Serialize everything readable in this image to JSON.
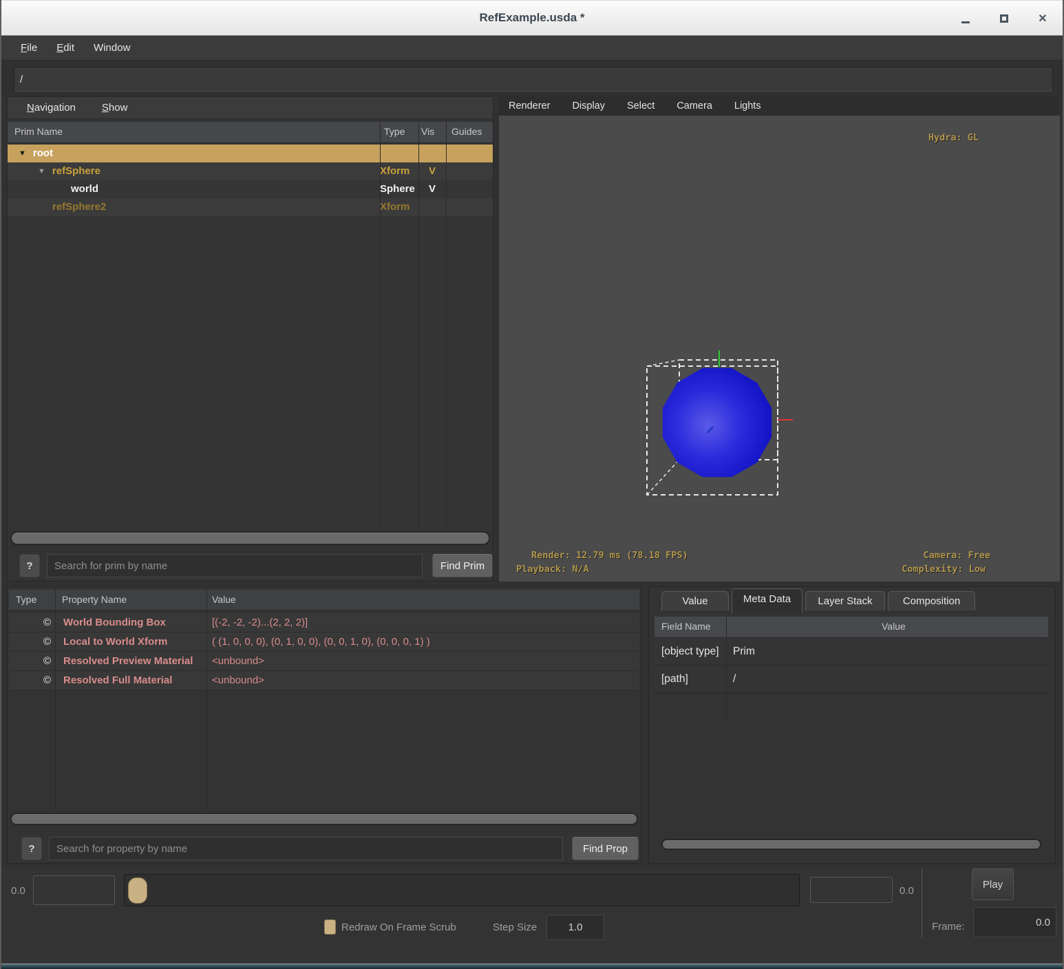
{
  "window": {
    "title": "RefExample.usda *",
    "controls": {
      "minimize": "minimize-icon",
      "maximize": "maximize-icon",
      "close_glyph": "✕"
    }
  },
  "menubar": {
    "file": "File",
    "edit": "Edit",
    "window": "Window"
  },
  "pathbar": {
    "value": "/"
  },
  "tree": {
    "menus": {
      "navigation": "Navigation",
      "show": "Show"
    },
    "columns": {
      "name": "Prim Name",
      "type": "Type",
      "vis": "Vis",
      "guides": "Guides"
    },
    "rows": [
      {
        "name": "root",
        "type": "",
        "vis": ""
      },
      {
        "name": "refSphere",
        "type": "Xform",
        "vis": "V"
      },
      {
        "name": "world",
        "type": "Sphere",
        "vis": "V"
      },
      {
        "name": "refSphere2",
        "type": "Xform",
        "vis": ""
      }
    ],
    "search": {
      "help": "?",
      "placeholder": "Search for prim by name",
      "button": "Find Prim"
    }
  },
  "viewport": {
    "menus": {
      "renderer": "Renderer",
      "display": "Display",
      "select": "Select",
      "camera": "Camera",
      "lights": "Lights"
    },
    "hud": {
      "hydra": "Hydra: GL",
      "render": "Render: 12.79 ms (78.18 FPS)",
      "playback": "Playback: N/A",
      "camera": "Camera: Free",
      "complexity": "Complexity: Low"
    }
  },
  "properties": {
    "columns": {
      "type": "Type",
      "name": "Property Name",
      "value": "Value"
    },
    "rows": [
      {
        "icon": "©",
        "name": "World Bounding Box",
        "value": "[(-2, -2, -2)...(2, 2, 2)]"
      },
      {
        "icon": "©",
        "name": "Local to World Xform",
        "value": "( (1, 0, 0, 0), (0, 1, 0, 0), (0, 0, 1, 0), (0, 0, 0, 1) )"
      },
      {
        "icon": "©",
        "name": "Resolved Preview Material",
        "value": "<unbound>"
      },
      {
        "icon": "©",
        "name": "Resolved Full Material",
        "value": "<unbound>"
      }
    ],
    "search": {
      "help": "?",
      "placeholder": "Search for property by name",
      "button": "Find Prop"
    }
  },
  "meta": {
    "tabs": {
      "value": "Value",
      "metadata": "Meta Data",
      "layerstack": "Layer Stack",
      "composition": "Composition"
    },
    "active_tab": "Meta Data",
    "columns": {
      "field": "Field Name",
      "value": "Value"
    },
    "rows": [
      {
        "field": "[object type]",
        "value": "Prim"
      },
      {
        "field": "[path]",
        "value": "/"
      }
    ]
  },
  "timeline": {
    "start_label": "0.0",
    "start_value": "",
    "end_value": "",
    "end_label": "0.0",
    "play": "Play",
    "frame_label": "Frame:",
    "frame_value": "0.0",
    "redraw_label": "Redraw On Frame Scrub",
    "step_label": "Step Size",
    "step_value": "1.0"
  },
  "colors": {
    "selection_tan": "#C7A25E",
    "prim_gold": "#C9A23D",
    "prim_dim_gold": "#97782E",
    "property_salmon": "#D98C8C",
    "sphere_blue": "#1A1AD8",
    "hud_gold": "#B0954D",
    "viewport_gray": "#4B4B4B",
    "accent_tan": "#C9B183",
    "bottom_strip_teal": "#2B4750"
  }
}
